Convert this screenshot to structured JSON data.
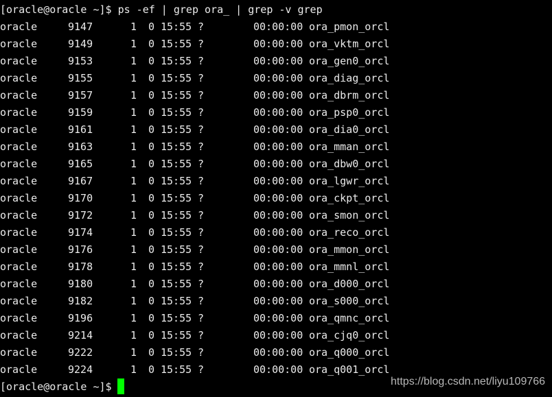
{
  "terminal": {
    "prompt": "[oracle@oracle ~]$ ",
    "command": "ps -ef | grep ora_ | grep -v grep",
    "cursor_color": "#00ff00",
    "rows": [
      {
        "uid": "oracle",
        "pid": "9147",
        "ppid": "1",
        "c": "0",
        "stime": "15:55",
        "tty": "?",
        "time": "00:00:00",
        "cmd": "ora_pmon_orcl"
      },
      {
        "uid": "oracle",
        "pid": "9149",
        "ppid": "1",
        "c": "0",
        "stime": "15:55",
        "tty": "?",
        "time": "00:00:00",
        "cmd": "ora_vktm_orcl"
      },
      {
        "uid": "oracle",
        "pid": "9153",
        "ppid": "1",
        "c": "0",
        "stime": "15:55",
        "tty": "?",
        "time": "00:00:00",
        "cmd": "ora_gen0_orcl"
      },
      {
        "uid": "oracle",
        "pid": "9155",
        "ppid": "1",
        "c": "0",
        "stime": "15:55",
        "tty": "?",
        "time": "00:00:00",
        "cmd": "ora_diag_orcl"
      },
      {
        "uid": "oracle",
        "pid": "9157",
        "ppid": "1",
        "c": "0",
        "stime": "15:55",
        "tty": "?",
        "time": "00:00:00",
        "cmd": "ora_dbrm_orcl"
      },
      {
        "uid": "oracle",
        "pid": "9159",
        "ppid": "1",
        "c": "0",
        "stime": "15:55",
        "tty": "?",
        "time": "00:00:00",
        "cmd": "ora_psp0_orcl"
      },
      {
        "uid": "oracle",
        "pid": "9161",
        "ppid": "1",
        "c": "0",
        "stime": "15:55",
        "tty": "?",
        "time": "00:00:00",
        "cmd": "ora_dia0_orcl"
      },
      {
        "uid": "oracle",
        "pid": "9163",
        "ppid": "1",
        "c": "0",
        "stime": "15:55",
        "tty": "?",
        "time": "00:00:00",
        "cmd": "ora_mman_orcl"
      },
      {
        "uid": "oracle",
        "pid": "9165",
        "ppid": "1",
        "c": "0",
        "stime": "15:55",
        "tty": "?",
        "time": "00:00:00",
        "cmd": "ora_dbw0_orcl"
      },
      {
        "uid": "oracle",
        "pid": "9167",
        "ppid": "1",
        "c": "0",
        "stime": "15:55",
        "tty": "?",
        "time": "00:00:00",
        "cmd": "ora_lgwr_orcl"
      },
      {
        "uid": "oracle",
        "pid": "9170",
        "ppid": "1",
        "c": "0",
        "stime": "15:55",
        "tty": "?",
        "time": "00:00:00",
        "cmd": "ora_ckpt_orcl"
      },
      {
        "uid": "oracle",
        "pid": "9172",
        "ppid": "1",
        "c": "0",
        "stime": "15:55",
        "tty": "?",
        "time": "00:00:00",
        "cmd": "ora_smon_orcl"
      },
      {
        "uid": "oracle",
        "pid": "9174",
        "ppid": "1",
        "c": "0",
        "stime": "15:55",
        "tty": "?",
        "time": "00:00:00",
        "cmd": "ora_reco_orcl"
      },
      {
        "uid": "oracle",
        "pid": "9176",
        "ppid": "1",
        "c": "0",
        "stime": "15:55",
        "tty": "?",
        "time": "00:00:00",
        "cmd": "ora_mmon_orcl"
      },
      {
        "uid": "oracle",
        "pid": "9178",
        "ppid": "1",
        "c": "0",
        "stime": "15:55",
        "tty": "?",
        "time": "00:00:00",
        "cmd": "ora_mmnl_orcl"
      },
      {
        "uid": "oracle",
        "pid": "9180",
        "ppid": "1",
        "c": "0",
        "stime": "15:55",
        "tty": "?",
        "time": "00:00:00",
        "cmd": "ora_d000_orcl"
      },
      {
        "uid": "oracle",
        "pid": "9182",
        "ppid": "1",
        "c": "0",
        "stime": "15:55",
        "tty": "?",
        "time": "00:00:00",
        "cmd": "ora_s000_orcl"
      },
      {
        "uid": "oracle",
        "pid": "9196",
        "ppid": "1",
        "c": "0",
        "stime": "15:55",
        "tty": "?",
        "time": "00:00:00",
        "cmd": "ora_qmnc_orcl"
      },
      {
        "uid": "oracle",
        "pid": "9214",
        "ppid": "1",
        "c": "0",
        "stime": "15:55",
        "tty": "?",
        "time": "00:00:00",
        "cmd": "ora_cjq0_orcl"
      },
      {
        "uid": "oracle",
        "pid": "9222",
        "ppid": "1",
        "c": "0",
        "stime": "15:55",
        "tty": "?",
        "time": "00:00:00",
        "cmd": "ora_q000_orcl"
      },
      {
        "uid": "oracle",
        "pid": "9224",
        "ppid": "1",
        "c": "0",
        "stime": "15:55",
        "tty": "?",
        "time": "00:00:00",
        "cmd": "ora_q001_orcl"
      }
    ]
  },
  "watermark": "https://blog.csdn.net/liyu109766"
}
